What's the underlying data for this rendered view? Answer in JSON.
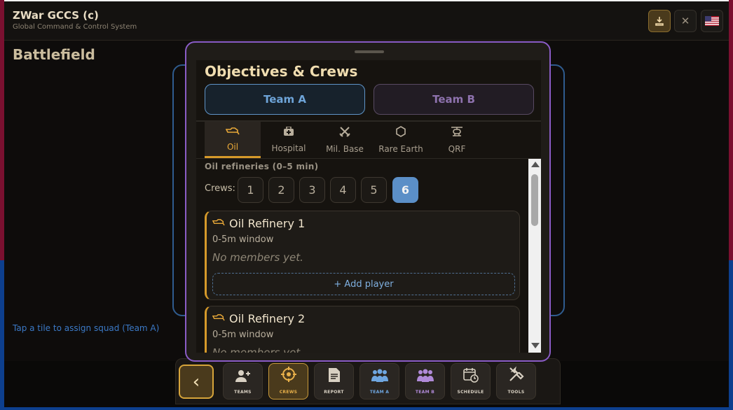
{
  "header": {
    "title": "ZWar GCCS (c)",
    "subtitle": "Global Command & Control System",
    "download_icon": "download-icon",
    "close_icon": "close-icon",
    "flag_icon": "us-flag-icon"
  },
  "main": {
    "page_title": "Battlefield",
    "hint": "Tap a tile to assign squad (Team A)"
  },
  "modal": {
    "title": "Objectives & Crews",
    "teams": [
      "Team A",
      "Team B"
    ],
    "selected_team": "Team A",
    "tabs": [
      {
        "label": "Oil",
        "icon": "oil-icon",
        "glyph": "⛽"
      },
      {
        "label": "Hospital",
        "icon": "hospital-icon",
        "glyph": "✚"
      },
      {
        "label": "Mil. Base",
        "icon": "crossed-swords-icon",
        "glyph": "⚔"
      },
      {
        "label": "Rare Earth",
        "icon": "hexagon-icon",
        "glyph": "⬡"
      },
      {
        "label": "QRF",
        "icon": "helicopter-icon",
        "glyph": "✈"
      }
    ],
    "active_tab": "Oil",
    "section_title": "Oil refineries (0–5 min)",
    "crews_label": "Crews:",
    "crew_options": [
      "1",
      "2",
      "3",
      "4",
      "5",
      "6"
    ],
    "selected_crew": "6",
    "cards": [
      {
        "title": "Oil Refinery 1",
        "window": "0-5m window",
        "empty": "No members yet.",
        "add": "+ Add player"
      },
      {
        "title": "Oil Refinery 2",
        "window": "0-5m window",
        "empty": "No members yet."
      }
    ]
  },
  "nav": {
    "back_icon": "chevron-left-icon",
    "items": [
      {
        "label": "TEAMS",
        "icon": "add-user-icon"
      },
      {
        "label": "CREWS",
        "icon": "crosshair-icon"
      },
      {
        "label": "REPORT",
        "icon": "document-icon"
      },
      {
        "label": "TEAM A",
        "icon": "group-icon"
      },
      {
        "label": "TEAM B",
        "icon": "group-icon"
      },
      {
        "label": "SCHEDULE",
        "icon": "calendar-icon"
      },
      {
        "label": "TOOLS",
        "icon": "tools-icon"
      }
    ],
    "active": "CREWS"
  },
  "colors": {
    "accent": "#d69a2a",
    "team_a": "#5b8fc7",
    "team_b": "#8e72ae",
    "modal_border": "#8a5cc6"
  }
}
